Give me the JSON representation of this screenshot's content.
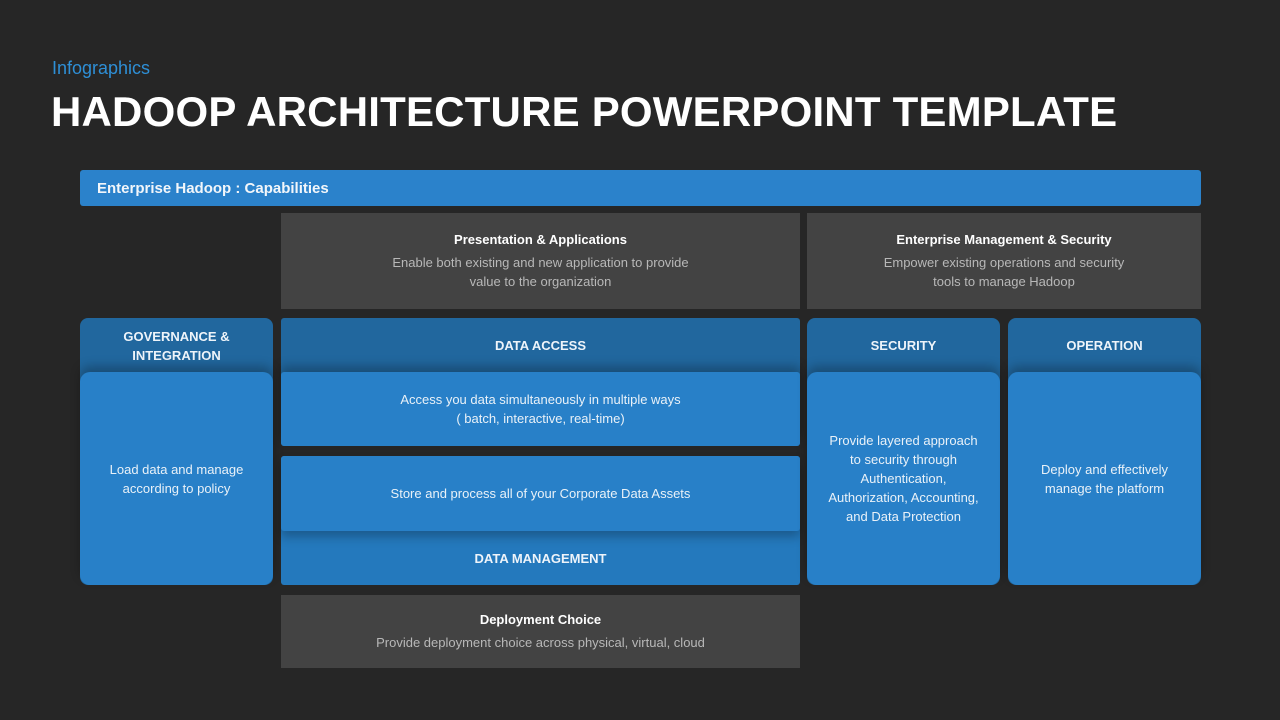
{
  "header": {
    "subtitle": "Infographics",
    "title": "HADOOP ARCHITECTURE POWERPOINT TEMPLATE"
  },
  "banner": {
    "label": "Enterprise Hadoop : Capabilities"
  },
  "presentation": {
    "heading": "Presentation & Applications",
    "line1": "Enable both  existing and new application to provide",
    "line2": "value to the organization"
  },
  "enterprise_mgmt": {
    "heading": "Enterprise Management & Security",
    "line1": "Empower  existing operations and security",
    "line2": "tools to manage Hadoop"
  },
  "governance": {
    "heading_line1": "GOVERNANCE &",
    "heading_line2": "INTEGRATION",
    "line1": "Load data and manage",
    "line2": "according to policy"
  },
  "data_access": {
    "heading": "DATA ACCESS",
    "line1": "Access you data simultaneously in multiple  ways",
    "line2": "( batch, interactive, real-time)"
  },
  "data_management": {
    "heading": "DATA MANAGEMENT",
    "text": "Store  and process all of your  Corporate  Data Assets"
  },
  "security": {
    "heading": "SECURITY",
    "lines": [
      "Provide  layered approach",
      "to security through",
      "Authentication,",
      "Authorization,  Accounting,",
      "and Data Protection"
    ]
  },
  "operation": {
    "heading": "OPERATION",
    "line1": "Deploy and effectively",
    "line2": "manage the platform"
  },
  "deployment": {
    "heading": "Deployment Choice",
    "text": "Provide  deployment  choice across physical, virtual, cloud"
  },
  "colors": {
    "background": "#262626",
    "accent_blue": "#2b82cb",
    "header_blue": "#21679e",
    "body_blue": "#2880c8",
    "gray_panel": "#434343",
    "subtitle_blue": "#2e8fd6"
  }
}
